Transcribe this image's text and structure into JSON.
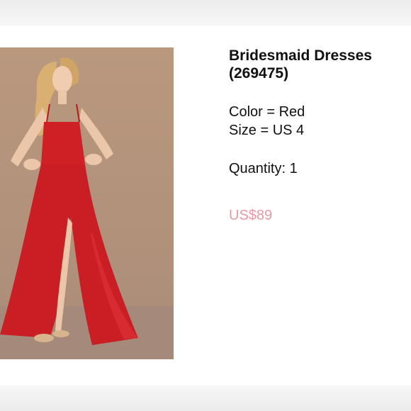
{
  "product": {
    "title": "Bridesmaid Dresses (269475)",
    "color_label": "Color = Red",
    "size_label": "Size = US 4",
    "quantity_label": "Quantity: 1",
    "price": "US$89",
    "price_color": "#e69aa3",
    "image": {
      "icon": "product-photo",
      "background_color": "#b39480",
      "dress_color": "#cf2026"
    }
  }
}
